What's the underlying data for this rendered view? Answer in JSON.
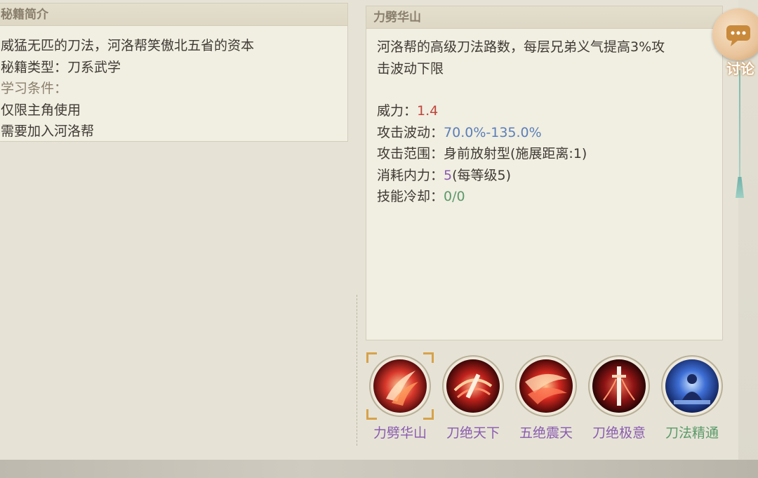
{
  "intro_panel": {
    "title": "秘籍简介",
    "lines": [
      "威猛无匹的刀法，河洛帮笑傲北五省的资本",
      "秘籍类型：刀系武学",
      "学习条件：",
      "仅限主角使用",
      "需要加入河洛帮"
    ]
  },
  "skill_panel": {
    "title": "力劈华山",
    "description_line1": "河洛帮的高级刀法路数，每层兄弟义气提高3%攻",
    "description_line2": "击波动下限",
    "stats": [
      {
        "label": "威力：",
        "value": "1.4",
        "color": "#c0453a"
      },
      {
        "label": "攻击波动：",
        "value": "70.0%-135.0%",
        "color": "#5a7fb8"
      },
      {
        "label": "攻击范围：",
        "value": "身前放射型(施展距离:1)",
        "color": "#3f3a34"
      },
      {
        "label": "消耗内力：",
        "value": "5",
        "suffix": "(每等级5)",
        "color": "#8a5bb0"
      },
      {
        "label": "技能冷却：",
        "value": "0/0",
        "color": "#5b9a6a"
      }
    ]
  },
  "skills": [
    {
      "name": "力劈华山",
      "color": "#8a5bb0",
      "icon": "red-slash-icon",
      "selected": true
    },
    {
      "name": "刀绝天下",
      "color": "#8a5bb0",
      "icon": "red-blade-swirl-icon"
    },
    {
      "name": "五绝震天",
      "color": "#8a5bb0",
      "icon": "red-flame-wave-icon"
    },
    {
      "name": "刀绝极意",
      "color": "#8a5bb0",
      "icon": "red-sword-pillar-icon"
    },
    {
      "name": "刀法精通",
      "color": "#5b9a6a",
      "icon": "blue-meditation-icon"
    }
  ],
  "discuss_button": {
    "label": "讨论",
    "icon": "chat-bubble-icon"
  }
}
